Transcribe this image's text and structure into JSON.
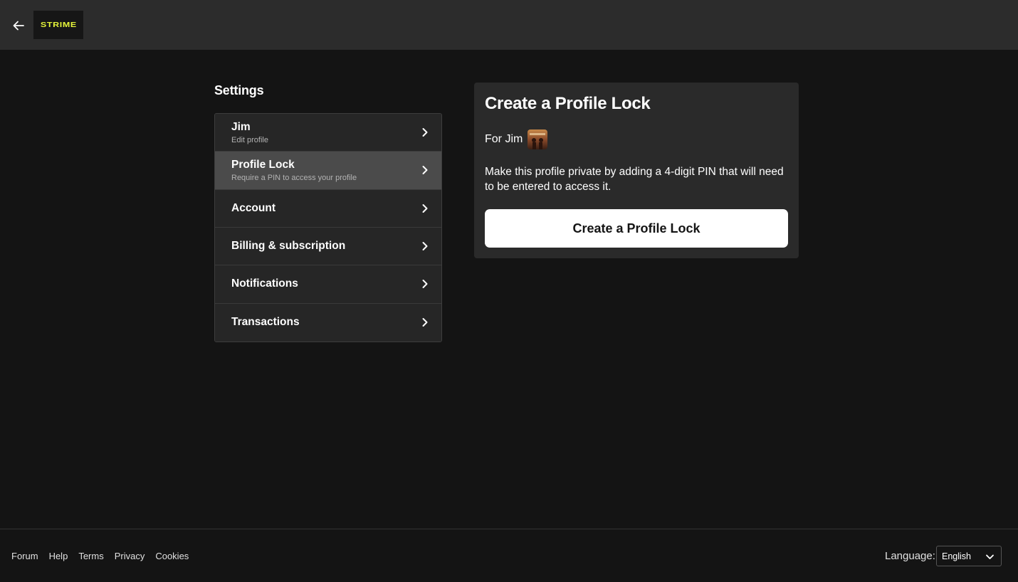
{
  "header": {
    "back_icon": "arrow-left-icon",
    "logo_text": "STRIME",
    "logo_color": "#e6f53a"
  },
  "settings": {
    "title": "Settings",
    "items": [
      {
        "label": "Jim",
        "sub": "Edit profile",
        "active": false
      },
      {
        "label": "Profile Lock",
        "sub": "Require a PIN to access your profile",
        "active": true
      },
      {
        "label": "Account",
        "sub": "",
        "active": false
      },
      {
        "label": "Billing & subscription",
        "sub": "",
        "active": false
      },
      {
        "label": "Notifications",
        "sub": "",
        "active": false
      },
      {
        "label": "Transactions",
        "sub": "",
        "active": false
      }
    ]
  },
  "panel": {
    "title": "Create a Profile Lock",
    "for_text": "For Jim",
    "description": "Make this profile private by adding a 4-digit PIN that will need to be entered to access it.",
    "button_label": "Create a Profile Lock"
  },
  "footer": {
    "links": [
      "Forum",
      "Help",
      "Terms",
      "Privacy",
      "Cookies"
    ],
    "language_label": "Language:",
    "language_value": "English"
  }
}
